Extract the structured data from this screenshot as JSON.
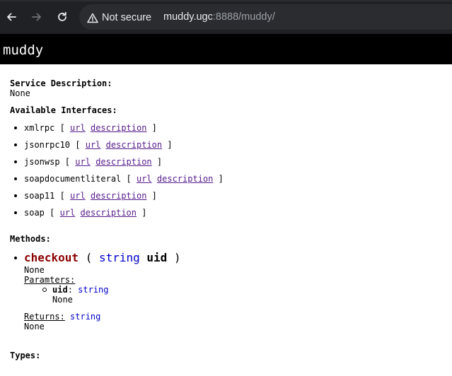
{
  "browser": {
    "security_label": "Not secure",
    "url_host": "muddy.ugc",
    "url_rest": ":8888/muddy/"
  },
  "page": {
    "title": "muddy",
    "service_description_label": "Service Description:",
    "service_description_value": "None",
    "interfaces_label": "Available Interfaces:",
    "interfaces": [
      {
        "name": "xmlrpc",
        "url_label": "url",
        "desc_label": "description"
      },
      {
        "name": "jsonrpc10",
        "url_label": "url",
        "desc_label": "description"
      },
      {
        "name": "jsonwsp",
        "url_label": "url",
        "desc_label": "description"
      },
      {
        "name": "soapdocumentliteral",
        "url_label": "url",
        "desc_label": "description"
      },
      {
        "name": "soap11",
        "url_label": "url",
        "desc_label": "description"
      },
      {
        "name": "soap",
        "url_label": "url",
        "desc_label": "description"
      }
    ],
    "methods_label": "Methods:",
    "method": {
      "name": "checkout",
      "param_type": "string",
      "param_name": "uid",
      "description": "None",
      "params_label": "Paramters:",
      "param_item_name": "uid",
      "param_item_type": "string",
      "param_item_desc": "None",
      "returns_label": "Returns:",
      "returns_type": "string",
      "returns_desc": "None"
    },
    "types_label": "Types:"
  },
  "colors": {
    "chrome_bg": "#202124",
    "method_name": "#8b0000",
    "type_blue": "#0000cd",
    "link_visited": "#551a8b"
  }
}
